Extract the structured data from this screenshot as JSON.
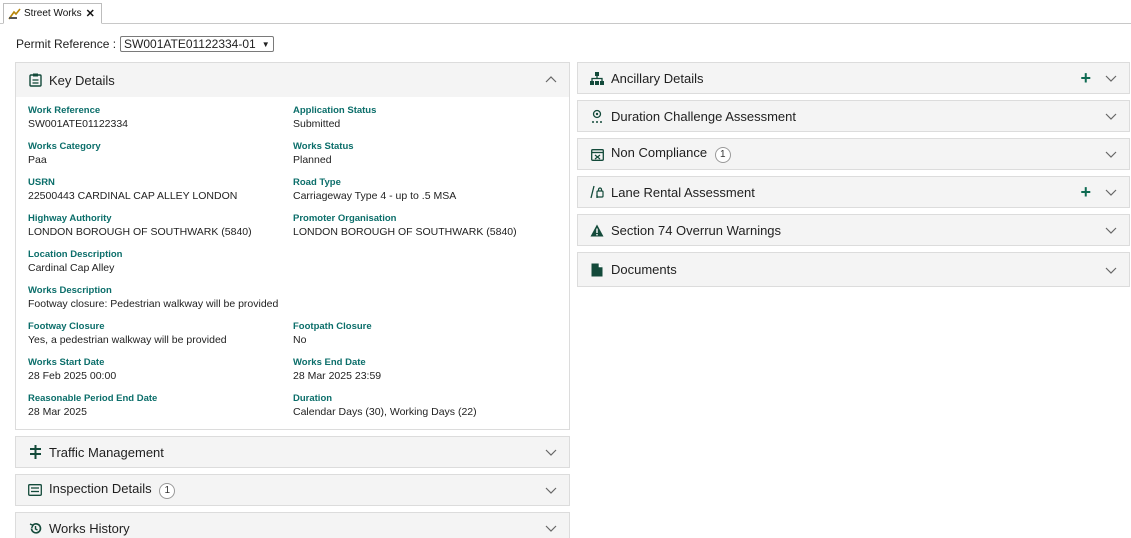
{
  "tab": {
    "label": "Street Works",
    "close": "✕"
  },
  "permit": {
    "label": "Permit Reference :",
    "value": "SW001ATE01122334-01",
    "caret": "▼"
  },
  "key_details": {
    "title": "Key Details",
    "fields": {
      "work_reference": {
        "label": "Work Reference",
        "value": "SW001ATE01122334"
      },
      "application_status": {
        "label": "Application Status",
        "value": "Submitted"
      },
      "works_category": {
        "label": "Works Category",
        "value": "Paa"
      },
      "works_status": {
        "label": "Works Status",
        "value": "Planned"
      },
      "usrn": {
        "label": "USRN",
        "value": "22500443 CARDINAL CAP ALLEY LONDON"
      },
      "road_type": {
        "label": "Road Type",
        "value": "Carriageway Type 4 - up to .5 MSA"
      },
      "highway_authority": {
        "label": "Highway Authority",
        "value": "LONDON BOROUGH OF SOUTHWARK (5840)"
      },
      "promoter_organisation": {
        "label": "Promoter Organisation",
        "value": "LONDON BOROUGH OF SOUTHWARK (5840)"
      },
      "location_description": {
        "label": "Location Description",
        "value": "Cardinal Cap Alley"
      },
      "works_description": {
        "label": "Works Description",
        "value": "Footway closure: Pedestrian walkway will be provided"
      },
      "footway_closure": {
        "label": "Footway Closure",
        "value": "Yes, a pedestrian walkway will be provided"
      },
      "footpath_closure": {
        "label": "Footpath Closure",
        "value": "No"
      },
      "works_start_date": {
        "label": "Works Start Date",
        "value": "28 Feb 2025 00:00"
      },
      "works_end_date": {
        "label": "Works End Date",
        "value": "28 Mar 2025 23:59"
      },
      "reasonable_period_end_date": {
        "label": "Reasonable Period End Date",
        "value": "28 Mar 2025"
      },
      "duration": {
        "label": "Duration",
        "value": "Calendar Days (30), Working Days (22)"
      }
    }
  },
  "left_panels": {
    "traffic_management": {
      "title": "Traffic Management"
    },
    "inspection_details": {
      "title": "Inspection Details",
      "badge": "1"
    },
    "works_history": {
      "title": "Works History"
    }
  },
  "right_panels": {
    "ancillary_details": {
      "title": "Ancillary Details"
    },
    "duration_challenge": {
      "title": "Duration Challenge Assessment"
    },
    "non_compliance": {
      "title": "Non Compliance",
      "badge": "1"
    },
    "lane_rental": {
      "title": "Lane Rental Assessment"
    },
    "section_74": {
      "title": "Section 74 Overrun Warnings"
    },
    "documents": {
      "title": "Documents"
    }
  },
  "colors": {
    "accent": "#0e6b52",
    "label_teal": "#0b6e6a",
    "header_bg": "#f4f4f4"
  }
}
